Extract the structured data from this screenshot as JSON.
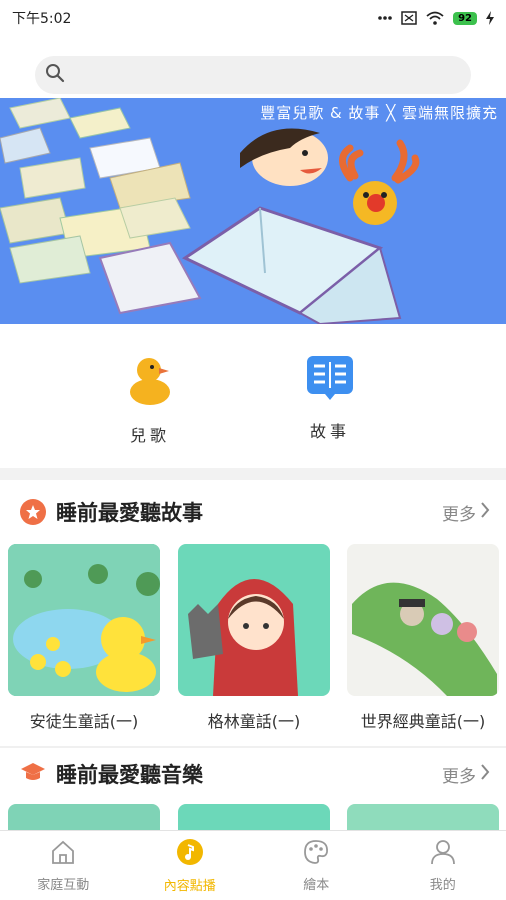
{
  "status_bar": {
    "time": "下午5:02",
    "battery": "92"
  },
  "search": {
    "placeholder": ""
  },
  "banner": {
    "caption": "豐富兒歌 & 故事 ╳ 雲端無限擴充"
  },
  "categories": [
    {
      "label": "兒歌",
      "icon": "duck-icon"
    },
    {
      "label": "故事",
      "icon": "book-icon"
    }
  ],
  "sections": [
    {
      "title": "睡前最愛聽故事",
      "more": "更多",
      "icon": "star-badge-icon",
      "items": [
        {
          "name": "安徒生童話(一)"
        },
        {
          "name": "格林童話(一)"
        },
        {
          "name": "世界經典童話(一)"
        }
      ]
    },
    {
      "title": "睡前最愛聽音樂",
      "more": "更多",
      "icon": "graduation-cap-icon"
    }
  ],
  "tabs": [
    {
      "label": "家庭互動",
      "icon": "home-icon",
      "active": false
    },
    {
      "label": "內容點播",
      "icon": "music-note-icon",
      "active": true
    },
    {
      "label": "繪本",
      "icon": "palette-icon",
      "active": false
    },
    {
      "label": "我的",
      "icon": "person-icon",
      "active": false
    }
  ],
  "colors": {
    "accent": "#f2b700",
    "banner": "#5a8ef0",
    "section_icon": "#ef7046"
  }
}
